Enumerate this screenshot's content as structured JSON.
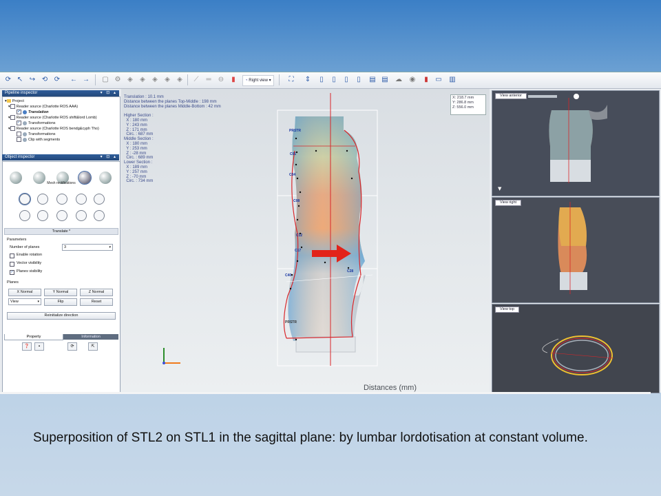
{
  "toolbar": {
    "view_label": "Right view"
  },
  "pipeline": {
    "title": "Pipeline inspector",
    "items": [
      {
        "label": "Project"
      },
      {
        "label": "Reader source (Charlotte ROS AAA)"
      },
      {
        "label": "Translation"
      },
      {
        "label": "Reader source (Charlotte ROS shift&lord Lomb)"
      },
      {
        "label": "Transformations"
      },
      {
        "label": "Reader source (Charlotte ROS bendg&cyph Tho)"
      },
      {
        "label": "Transformations"
      },
      {
        "label": "Clip with segments"
      }
    ]
  },
  "object_inspector": {
    "title": "Object inspector",
    "section_label": "Mesh rectifications",
    "translate_label": "Translate *",
    "parameters_label": "Parameters",
    "num_planes_label": "Number of planes",
    "num_planes_value": "3",
    "enable_rotation": "Enable rotation",
    "vector_visibility": "Vector visibility",
    "planes_visibility": "Planes visibility",
    "planes_label": "Planes",
    "x_normal": "X Normal",
    "y_normal": "Y Normal",
    "z_normal": "Z Normal",
    "view_select": "View",
    "flip": "Flip",
    "reset": "Reset",
    "reinit": "Reinitialize direction",
    "tab_property": "Property",
    "tab_information": "Information"
  },
  "viewport": {
    "info": "Translation : 10.1 mm\nDistance between the planes Top-Middle : 198 mm\nDistance between the planes Middle-Bottom : 42 mm\n\nHigher Section :\n  X : 180 mm\n  Y : 243 mm\n  Z : 171 mm\n  Circ. : 687 mm\nMiddle Section :\n  X : 180 mm\n  Y : 253 mm\n  Z : -28 mm\n  Circ. : 689 mm\nLower Section :\n  X : 189 mm\n  Y : 257 mm\n  Z : -70 mm\n  Circ. : 734 mm",
    "coord_x": "X: 218.7 mm",
    "coord_y": "Y: 286.8 mm",
    "coord_z": "Z: 556.0 mm",
    "distances_label": "Distances (mm)",
    "markers": [
      "PRSTR",
      "C01",
      "C04",
      "C08",
      "C12",
      "C17",
      "C40",
      "PRSTR",
      "C28"
    ]
  },
  "side_views": {
    "anterior": "View anterior",
    "right": "View right",
    "top": "View top"
  },
  "caption": "Superposition of STL2 on STL1 in the sagittal plane: by lumbar lordotisation at constant volume.",
  "colors": {
    "heat_blue": "#6fa6d6",
    "heat_red": "#e05a2a",
    "arrow": "#e2231a",
    "axis_line": "#d9262a"
  }
}
